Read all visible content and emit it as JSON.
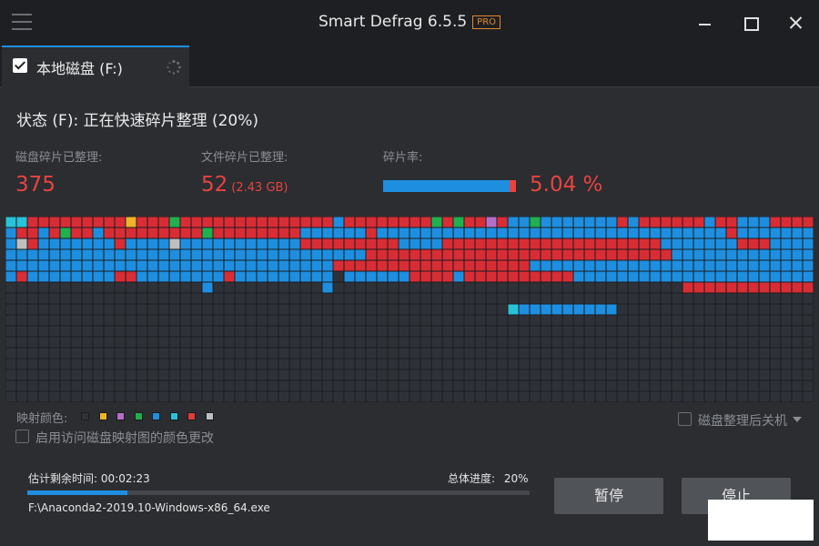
{
  "app": {
    "title": "Smart Defrag 6.5.5",
    "badge": "PRO"
  },
  "tab": {
    "label": "本地磁盘 (F:)"
  },
  "status": {
    "text": "状态 (F): 正在快速碎片整理 (20%)"
  },
  "stats": {
    "disk_label": "磁盘碎片已整理:",
    "disk_value": "375",
    "file_label": "文件碎片已整理:",
    "file_value": "52",
    "file_size": "(2.43 GB)",
    "frag_label": "碎片率:",
    "frag_value": "5.04 %",
    "frag_fraction": 0.0504
  },
  "legend": {
    "label": "映射颜色:",
    "colors": [
      "#2e3238",
      "#f0b429",
      "#b46ec8",
      "#20b050",
      "#1e8fe0",
      "#29c3d8",
      "#e03a3a",
      "#bfbfbf"
    ]
  },
  "options": {
    "shutdown_label": "磁盘整理后关机",
    "shutdown_checked": false,
    "map_color_label": "启用访问磁盘映射图的颜色更改",
    "map_color_checked": false
  },
  "progress": {
    "time_label": "估计剩余时间:",
    "time_value": "00:02:23",
    "overall_label": "总体进度:",
    "overall_value": "20%",
    "fraction": 0.2,
    "file_path": "F:\\Anaconda2-2019.10-Windows-x86_64.exe"
  },
  "buttons": {
    "pause_label": "暂停",
    "stop_label": "停止"
  },
  "disk_map": {
    "columns": 74,
    "rows": 17,
    "colors": {
      ".": "#2e3238",
      "R": "#d92d35",
      "B": "#1e8fe0",
      "C": "#29c3d8",
      "G": "#20b050",
      "Y": "#f0b429",
      "P": "#b46ec8",
      "W": "#bfbfbf"
    },
    "grid": [
      "CCRRRRRRRRRYRRRGRRRRRRRRRRRRRRBRRRRRRRRGRGRRPRBBGBBBBBBBRBRRRRRRBRRBBBRRRR",
      "BRRBRGRRBRRRRRRRRRGRRRRRRRRBBBBBBRBBBBBBBBBBBBBBBBBBBBBBBBBBBBBBBBRBBBBBBBB",
      "BWRBBBBBBBRBBBBWBBBBBBBBBBBRRRRRRRRRBBBBRRRRRRRRRRRRRRRRRRRRBBBBBBBRRRBBBBB",
      "BBBBBBBBBBBBBBBBBBBBBBBBBBBBBBBBBRRRRRRRRRRRRRRRRRRRRRRRRRRRRBBBBBBBBBBBBBBB",
      "BBBBBBBBBBBBBBBBBBBBBBBBBBBBBBRRRRRRRRRRRRRRRRRRBBBBBBBBBBBBBBBBBBBBBBBBBBB",
      "BRBBBBBBBBRRBBBBBBBBRBBBBBBBBB.BBBBBBRRRRBRRRRRRRRRRBBBBBBBBBBBBBBBBBBBBBBB",
      "..................B..........B................................RRRRRRRRRRRRR.RR",
      "..........................................................................",
      "..............................................CBBBBBBBBB..................",
      "..........................................................................",
      "..........................................................................",
      "..........................................................................",
      "..........................................................................",
      "..........................................................................",
      "..........................................................................",
      "..........................................................................",
      ".........................................................................."
    ]
  }
}
